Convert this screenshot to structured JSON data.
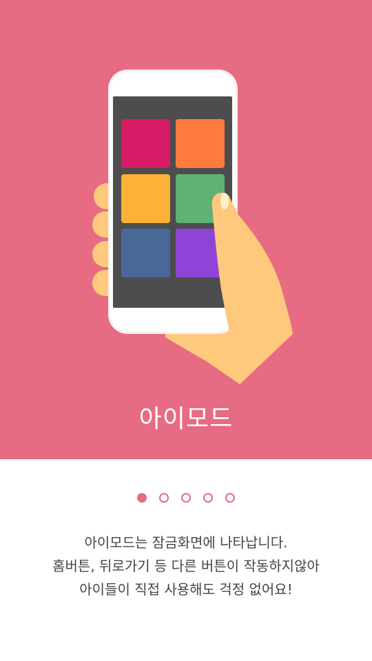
{
  "colors": {
    "hero_background": "#e76b82",
    "accent": "#e76b82",
    "text": "#444444",
    "tiles": [
      "#d81b66",
      "#ff7b3e",
      "#fbb236",
      "#5fb274",
      "#486897",
      "#8e44d6"
    ]
  },
  "hero": {
    "title": "아이모드",
    "illustration": "hand-holding-phone-illustration"
  },
  "pager": {
    "count": 5,
    "active_index": 0
  },
  "description": {
    "line1": "아이모드는 잠금화면에 나타납니다.",
    "line2": "홈버튼, 뒤로가기 등 다른 버튼이 작동하지않아",
    "line3": "아이들이 직접 사용해도 걱정 없어요!"
  }
}
